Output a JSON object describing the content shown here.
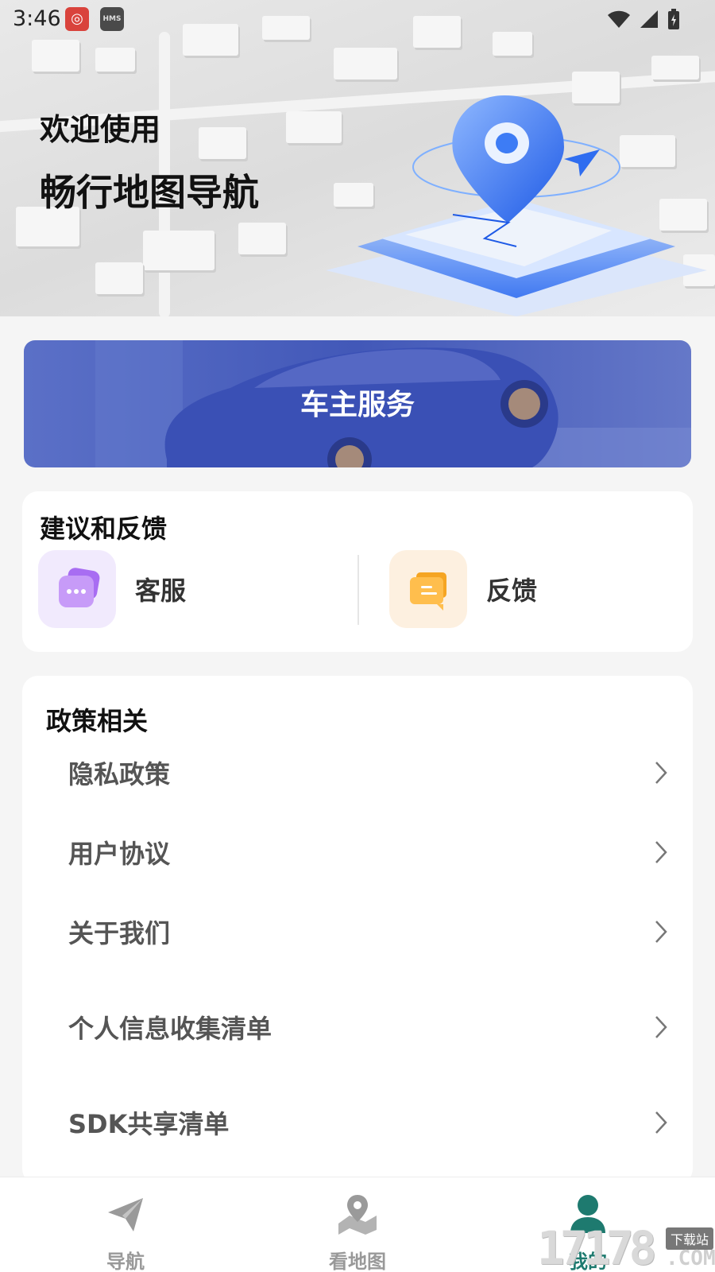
{
  "status_bar": {
    "time": "3:46",
    "app_icon_2": "HMS"
  },
  "hero": {
    "welcome": "欢迎使用",
    "app_name": "畅行地图导航"
  },
  "banner": {
    "label": "车主服务"
  },
  "feedback": {
    "title": "建议和反馈",
    "items": [
      {
        "label": "客服",
        "icon": "chat-bubbles-icon",
        "bg": "#f1eafd"
      },
      {
        "label": "反馈",
        "icon": "message-icon",
        "bg": "#fdf0e0"
      }
    ]
  },
  "policy": {
    "title": "政策相关",
    "items": [
      {
        "label": "隐私政策"
      },
      {
        "label": "用户协议"
      },
      {
        "label": "关于我们"
      },
      {
        "label": "个人信息收集清单"
      },
      {
        "label": "SDK共享清单"
      }
    ]
  },
  "bottom_nav": {
    "items": [
      {
        "label": "导航",
        "icon": "paper-plane-icon",
        "active": false
      },
      {
        "label": "看地图",
        "icon": "map-pin-icon",
        "active": false
      },
      {
        "label": "我的",
        "icon": "user-icon",
        "active": true
      }
    ]
  },
  "watermark": {
    "number": "17178",
    "badge": "下载站",
    "domain": ".COM"
  },
  "colors": {
    "accent": "#1e7a6f",
    "banner": "#4258b8",
    "inactive": "#999999"
  }
}
